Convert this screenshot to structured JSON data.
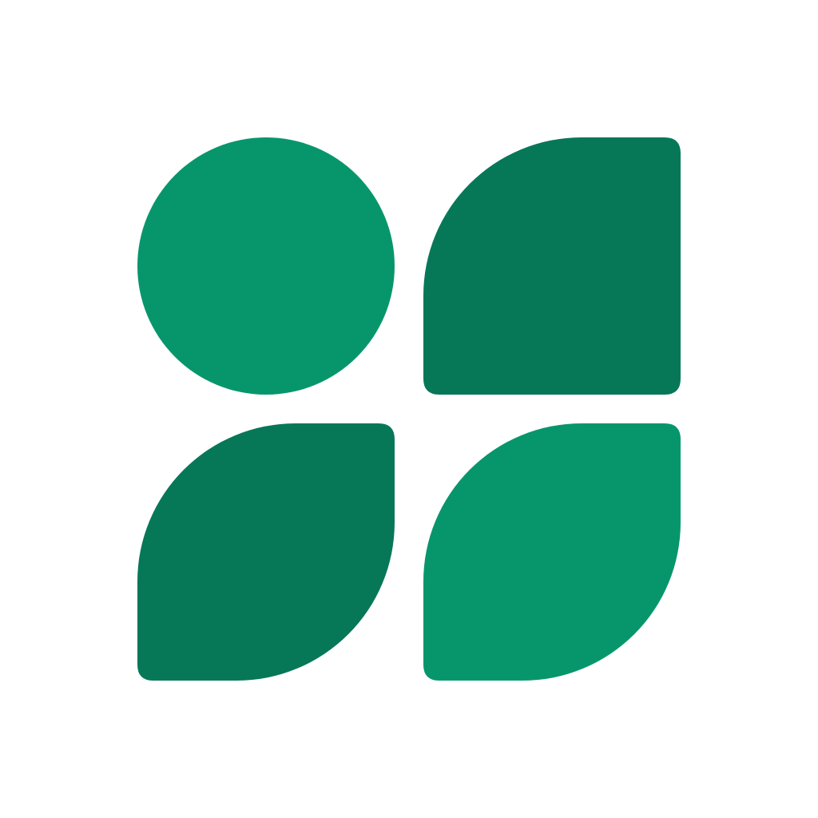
{
  "logo": {
    "icon": "four-petal-grid-logo",
    "colors": {
      "background": "#ffffff",
      "light_green": "#07966b",
      "dark_green": "#067857"
    },
    "tiles": [
      {
        "name": "top-left",
        "shape": "circle",
        "color": "light_green"
      },
      {
        "name": "top-right",
        "shape": "leaf-top-left-rounded",
        "color": "dark_green"
      },
      {
        "name": "bottom-left",
        "shape": "leaf-diagonal",
        "color": "dark_green"
      },
      {
        "name": "bottom-right",
        "shape": "leaf-diagonal",
        "color": "light_green"
      }
    ]
  }
}
